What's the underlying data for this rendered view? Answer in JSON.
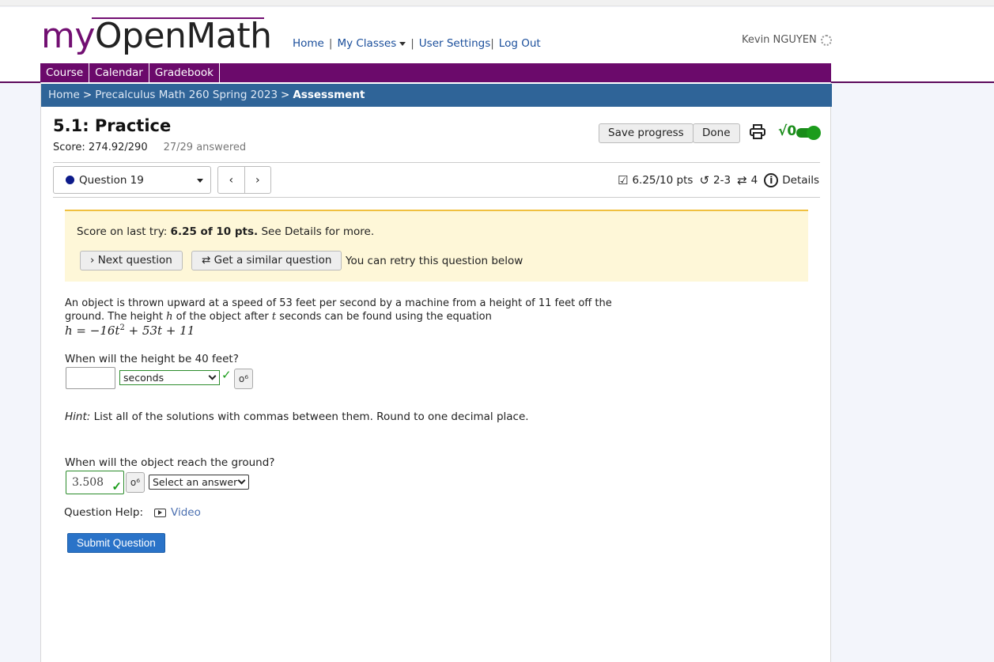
{
  "logo": {
    "my": "my",
    "openmath": "OpenMath"
  },
  "topnav": {
    "home": "Home",
    "my_classes": "My Classes",
    "user_settings": "User Settings",
    "log_out": "Log Out",
    "sep": "|"
  },
  "user": {
    "name": "Kevin NGUYEN"
  },
  "mainnav": [
    "Course",
    "Calendar",
    "Gradebook"
  ],
  "breadcrumb": {
    "home": "Home",
    "course": "Precalculus Math 260 Spring 2023",
    "current": "Assessment",
    "sep": ">"
  },
  "assessment": {
    "title": "5.1: Practice",
    "score": "Score: 274.92/290",
    "answered": "27/29 answered",
    "save_label": "Save progress",
    "done_label": "Done"
  },
  "question_nav": {
    "selected": "Question 19",
    "prev": "‹",
    "next": "›",
    "points": "6.25/10 pts",
    "attempts": "2-3",
    "versions": "4",
    "details": "Details"
  },
  "alert": {
    "prefix": "Score on last try:",
    "score": "6.25 of 10 pts.",
    "suffix": "See Details for more.",
    "next_label": "Next question",
    "similar_label": "Get a similar question",
    "retry": "You can retry this question below"
  },
  "problem": {
    "text1": "An object is thrown upward at a speed of 53 feet per second by a machine from a height of 11 feet off the ground. The height",
    "var_h": "h",
    "text2": "of the object after",
    "var_t": "t",
    "text3": "seconds can be found using the equation",
    "equation_lhs": "h = −16t",
    "equation_exp": "2",
    "equation_rhs": " + 53t + 11"
  },
  "part1": {
    "question": "When will the height be 40 feet?",
    "answer_value": "",
    "units_selected": "seconds"
  },
  "hint": {
    "label": "Hint:",
    "text": "List all of the solutions with commas between them. Round to one decimal place."
  },
  "part2": {
    "question": "When will the object reach the ground?",
    "answer_value": "3.508",
    "units_selected": "Select an answer"
  },
  "help": {
    "label": "Question Help:",
    "video": "Video"
  },
  "submit_label": "Submit Question",
  "icons": {
    "check": "✓",
    "key": "o⁶"
  },
  "colors": {
    "brand_purple": "#6b0a6b",
    "breadcrumb_blue": "#2f6498",
    "correct_green": "#1a9c1a",
    "submit_blue": "#2a73c8"
  }
}
